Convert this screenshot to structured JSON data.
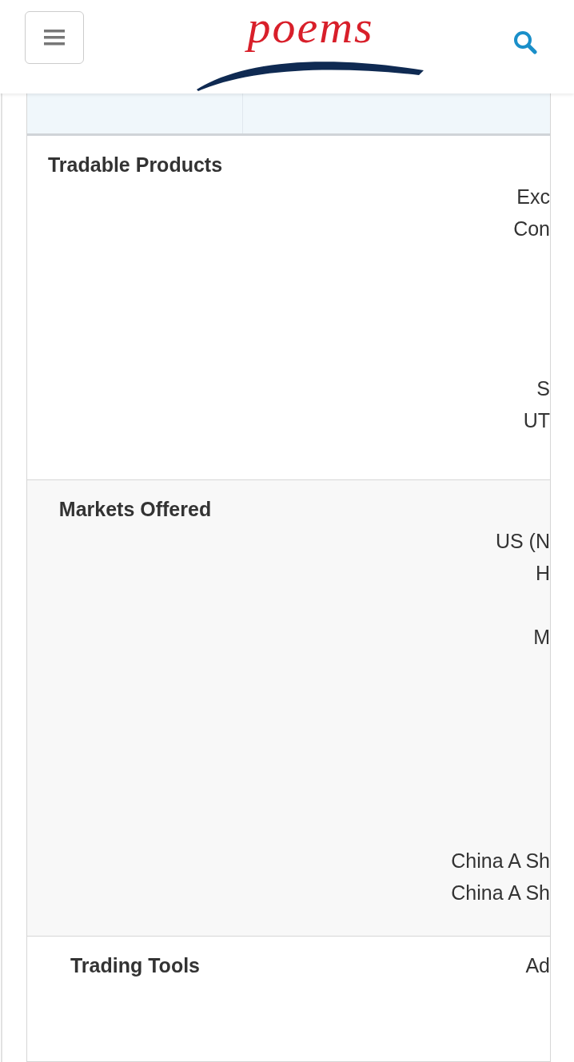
{
  "header": {
    "logo": "poems"
  },
  "table": {
    "rows": [
      {
        "label": "Tradable Products",
        "values": [
          "Exc",
          "Con",
          "S",
          "UT"
        ]
      },
      {
        "label": "Markets Offered",
        "values": [
          "US (N",
          "H",
          "M",
          "China A Sh",
          "China A Sh"
        ]
      },
      {
        "label": "Trading Tools",
        "values": [
          "Ad"
        ]
      }
    ]
  }
}
